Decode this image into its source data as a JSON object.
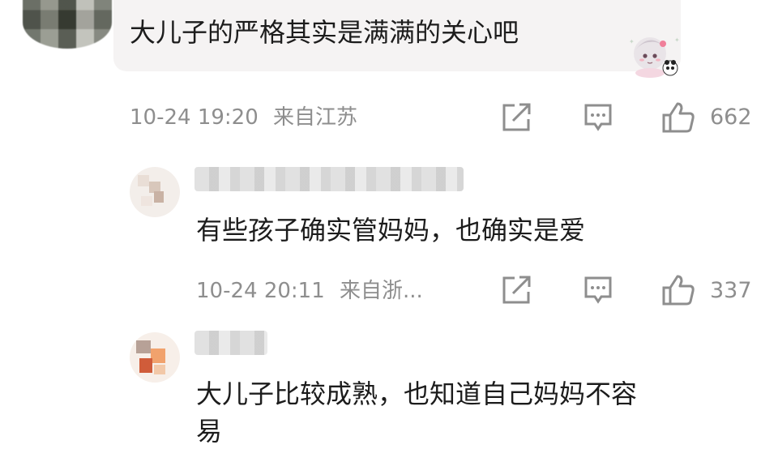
{
  "comment": {
    "text": "大儿子的严格其实是满满的关心吧",
    "time": "10-24 19:20",
    "location": "来自江苏",
    "likes": "662"
  },
  "replies": [
    {
      "text": "有些孩子确实管妈妈，也确实是爱",
      "time": "10-24 20:11",
      "location": "来自浙...",
      "likes": "337"
    },
    {
      "text": "大儿子比较成熟，也知道自己妈妈不容",
      "text_line2": "易"
    }
  ],
  "icons": {
    "share": "share-icon",
    "comment": "comment-icon",
    "like": "thumbs-up-icon"
  },
  "colors": {
    "text": "#1c1c1c",
    "meta": "#8e8e8e",
    "bubble": "#f5f3f3"
  }
}
